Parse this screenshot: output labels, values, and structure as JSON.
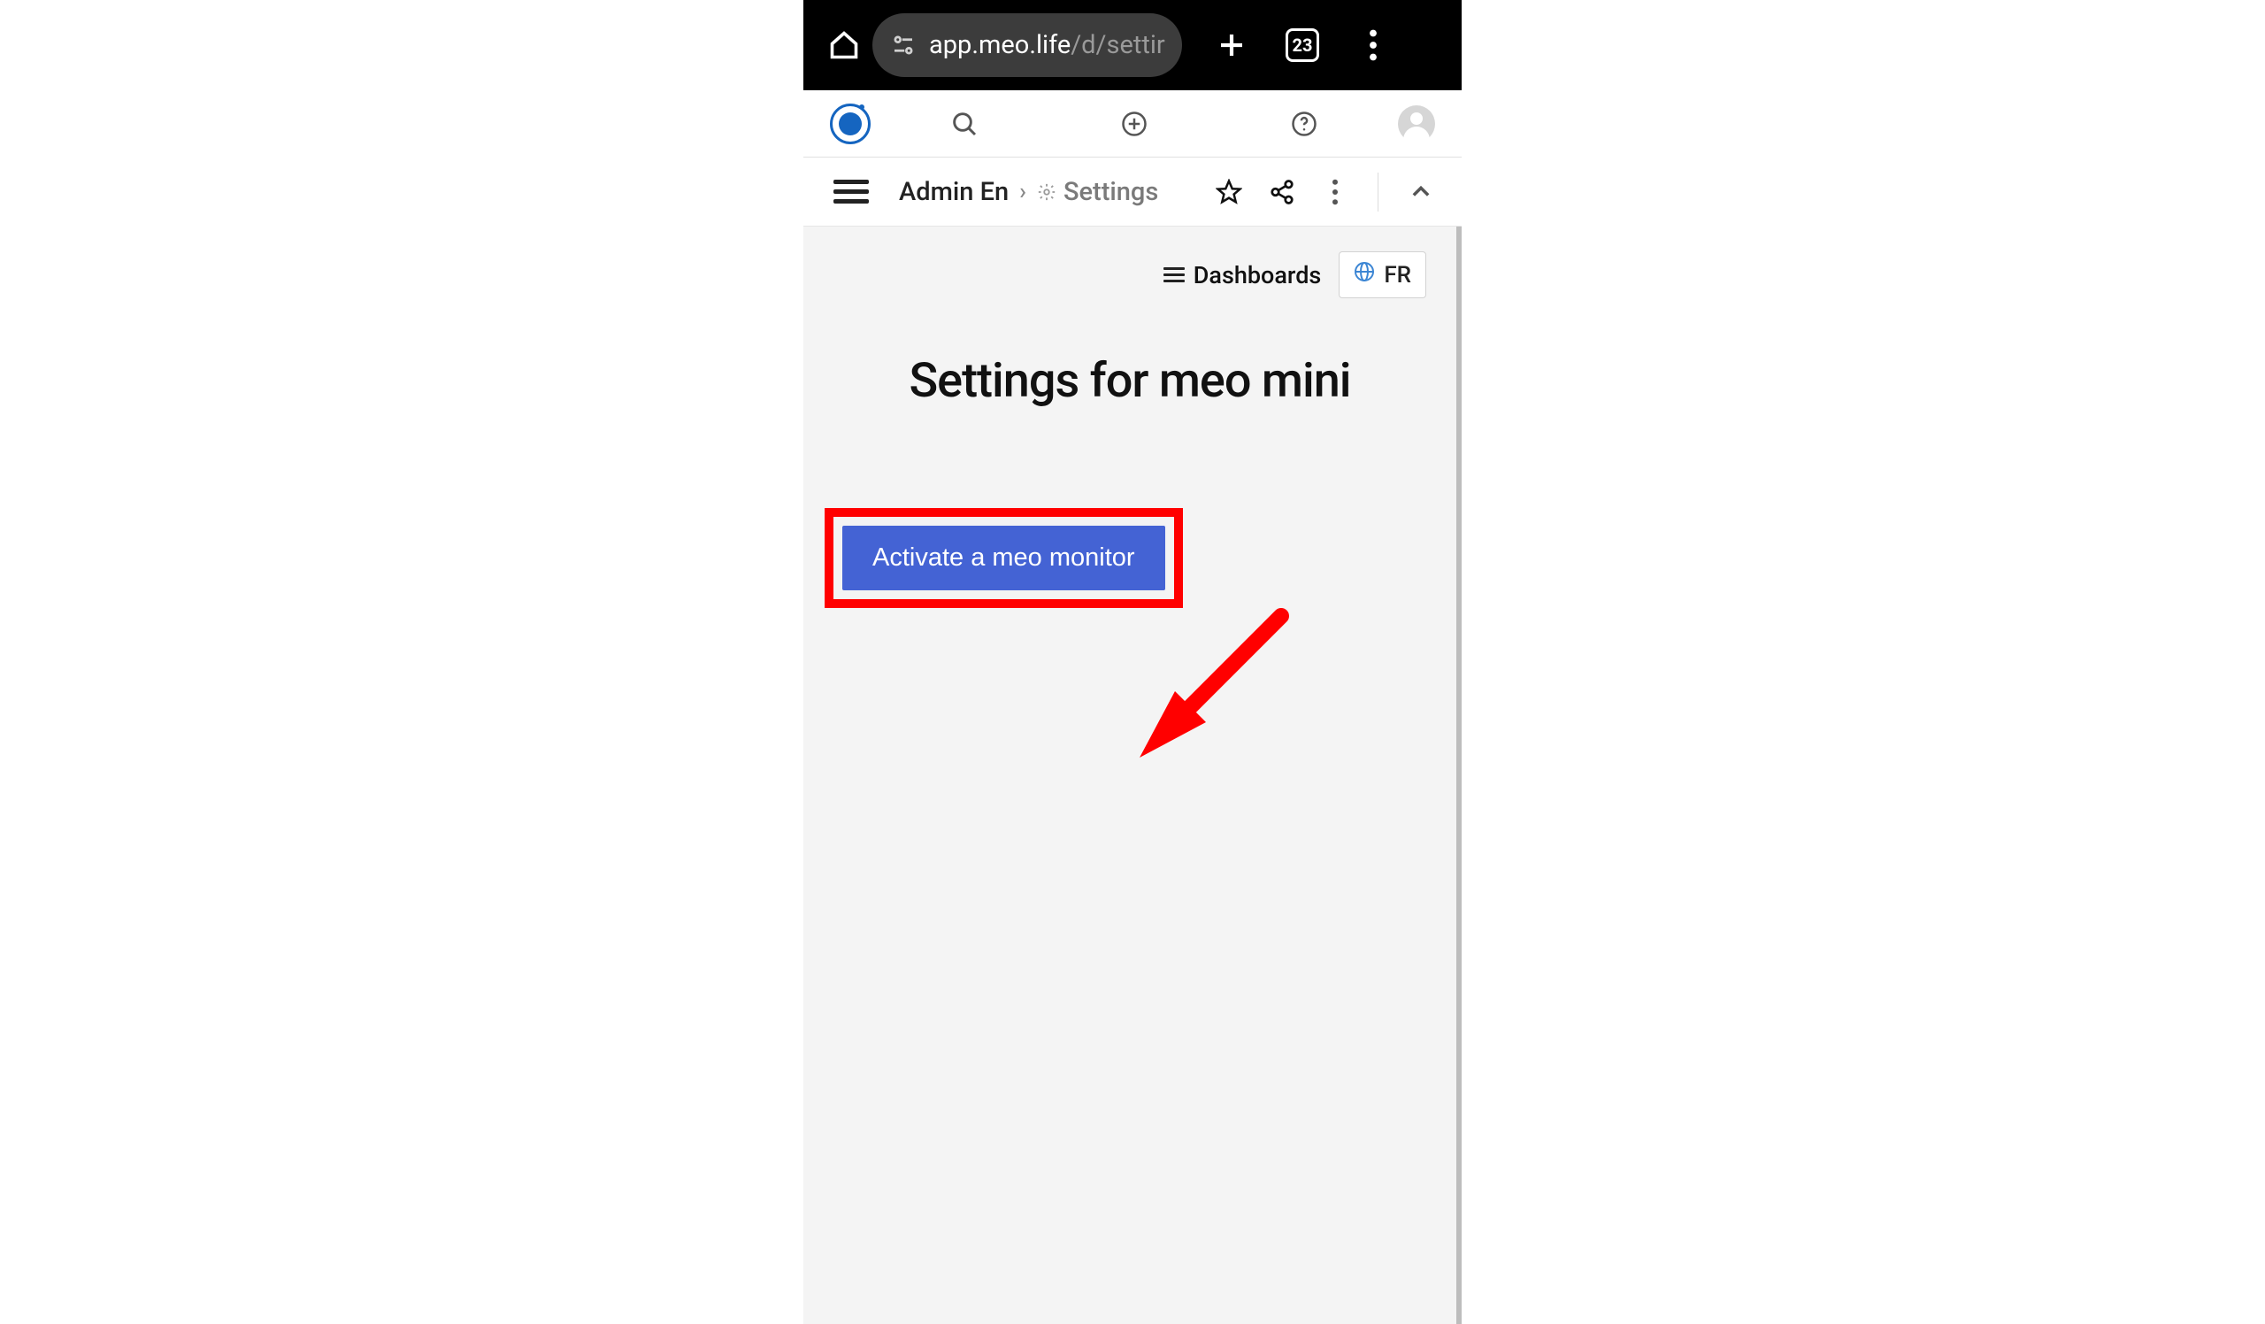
{
  "browser": {
    "url_domain": "app.meo.life",
    "url_path": "/d/settir",
    "tab_count": "23"
  },
  "breadcrumb": {
    "user_label": "Admin En",
    "separator": "›",
    "settings_label": "Settings"
  },
  "content": {
    "dashboards_label": "Dashboards",
    "language_label": "FR",
    "page_title": "Settings for meo mini",
    "activate_button_label": "Activate a meo monitor"
  }
}
